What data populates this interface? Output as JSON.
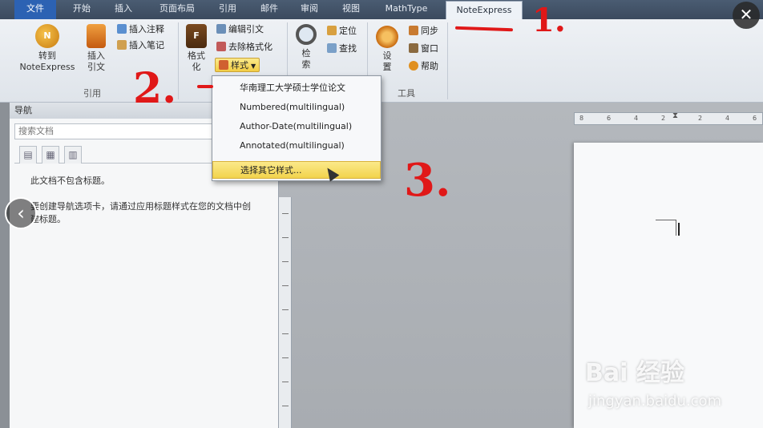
{
  "tabs": [
    "文件",
    "开始",
    "插入",
    "页面布局",
    "引用",
    "邮件",
    "审阅",
    "视图",
    "MathType",
    "NoteExpress"
  ],
  "ribbon": {
    "goto": "转到\nNoteExpress",
    "insert_cite": "插入\n引文",
    "insert_note": "插入注释",
    "insert_note2": "插入笔记",
    "format": "格式\n化",
    "edit_cite": "编辑引文",
    "remove_format": "去除格式化",
    "style": "样式",
    "search": "检\n索",
    "locate": "定位",
    "find": "查找",
    "settings": "设\n置",
    "sync": "同步",
    "window": "窗口",
    "help": "帮助",
    "group_cite": "引用",
    "group_tools": "工具"
  },
  "menu": {
    "items": [
      "华南理工大学硕士学位论文",
      "Numbered(multilingual)",
      "Author-Date(multilingual)",
      "Annotated(multilingual)"
    ],
    "more": "选择其它样式..."
  },
  "nav": {
    "title": "导航",
    "search_placeholder": "搜索文档",
    "msg1": "此文档不包含标题。",
    "msg2": "要创建导航选项卡，请通过应用标题样式在您的文档中创建标题。"
  },
  "ruler": [
    "8",
    "6",
    "4",
    "2",
    "2",
    "4",
    "6"
  ],
  "annotations": [
    "1.",
    "2.",
    "3."
  ],
  "watermark": {
    "logo": "Bai 经验",
    "url": "jingyan.baidu.com"
  },
  "controls": {
    "close": "✕",
    "prev": "‹"
  },
  "colors": {
    "accent_red": "#e01818",
    "highlight": "#f2d34c",
    "file_tab": "#2c62b3"
  }
}
